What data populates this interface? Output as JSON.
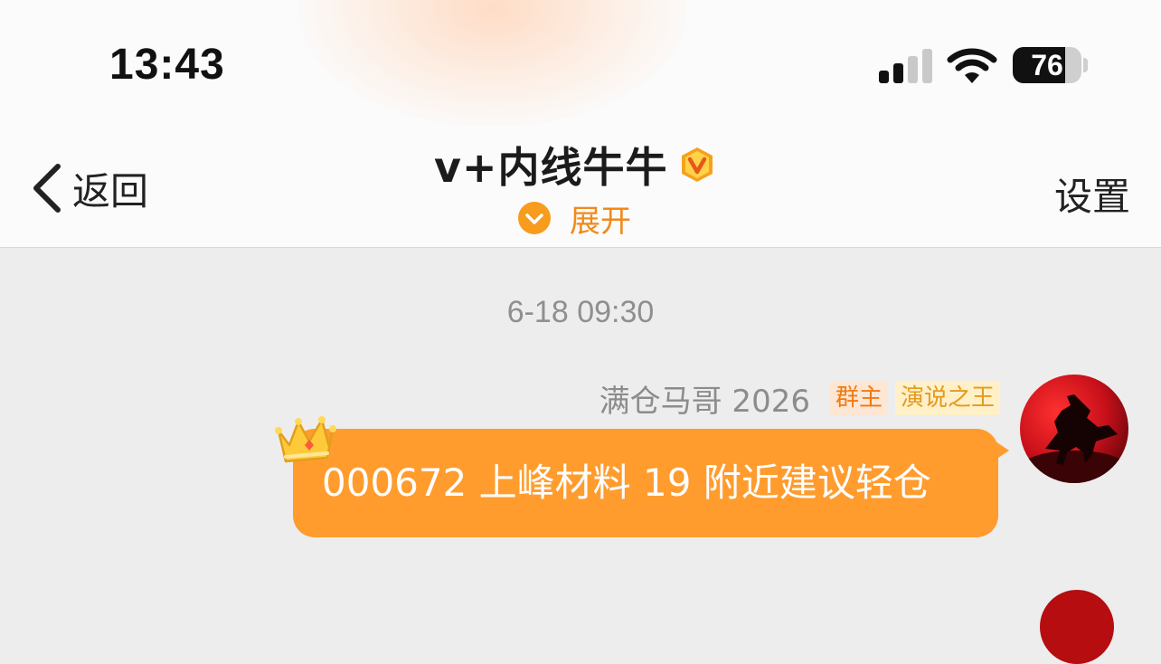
{
  "status_bar": {
    "time": "13:43",
    "battery_percent": "76",
    "battery_level": 0.76,
    "signal_bars_active": 2,
    "signal_bars_total": 4
  },
  "nav": {
    "back_label": "返回",
    "title": "v+内线牛牛",
    "expand_label": "展开",
    "settings_label": "设置"
  },
  "chat": {
    "timestamp": "6-18 09:30",
    "messages": [
      {
        "sender_name": "满仓马哥 2026",
        "badges": [
          "群主",
          "演说之王"
        ],
        "text": "000672 上峰材料 19 附近建议轻仓"
      }
    ]
  },
  "colors": {
    "accent_orange": "#ff9c2d",
    "expand_orange": "#f08a1a",
    "chat_background": "#ededed"
  },
  "icons": {
    "back": "chevron-left-icon",
    "verified": "v-badge-icon",
    "expand": "chevron-down-circle-icon",
    "crown": "crown-icon",
    "wifi": "wifi-icon",
    "signal": "cellular-signal-icon",
    "battery": "battery-icon"
  }
}
